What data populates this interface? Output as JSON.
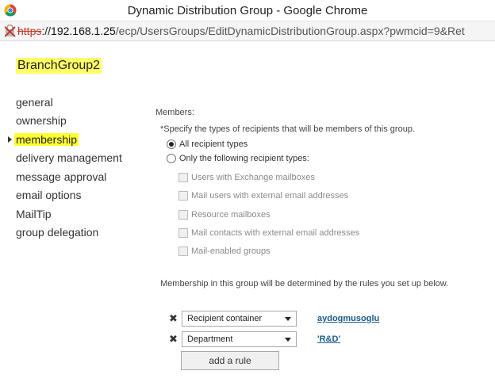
{
  "window": {
    "title": "Dynamic Distribution Group - Google Chrome",
    "url_scheme": "https",
    "url_separator": "://",
    "url_host": "192.168.1.25",
    "url_path": "/ecp/UsersGroups/EditDynamicDistributionGroup.aspx?pwmcid=9&Ret"
  },
  "group_name": "BranchGroup2",
  "nav": {
    "items": [
      {
        "label": "general"
      },
      {
        "label": "ownership"
      },
      {
        "label": "membership"
      },
      {
        "label": "delivery management"
      },
      {
        "label": "message approval"
      },
      {
        "label": "email options"
      },
      {
        "label": "MailTip"
      },
      {
        "label": "group delegation"
      }
    ],
    "active": "membership"
  },
  "members": {
    "heading": "Members:",
    "specify": "*Specify the types of recipients that will be members of this group.",
    "radios": [
      {
        "label": "All recipient types",
        "checked": true
      },
      {
        "label": "Only the following recipient types:",
        "checked": false
      }
    ],
    "types": [
      {
        "label": "Users with Exchange mailboxes",
        "checked": false
      },
      {
        "label": "Mail users with external email addresses",
        "checked": false
      },
      {
        "label": "Resource mailboxes",
        "checked": false
      },
      {
        "label": "Mail contacts with external email addresses",
        "checked": false
      },
      {
        "label": "Mail-enabled groups",
        "checked": false
      }
    ]
  },
  "rules": {
    "note": "Membership in this group will be determined by the rules you set up below.",
    "remove_glyph": "✖",
    "items": [
      {
        "field": "Recipient container",
        "value": "aydogmusoglu"
      },
      {
        "field": "Department",
        "value": "'R&D'"
      }
    ],
    "add_label": "add a rule"
  },
  "colors": {
    "highlight": "#ffff33",
    "link": "#1a5a8a",
    "https_struck": "#c0392b"
  }
}
